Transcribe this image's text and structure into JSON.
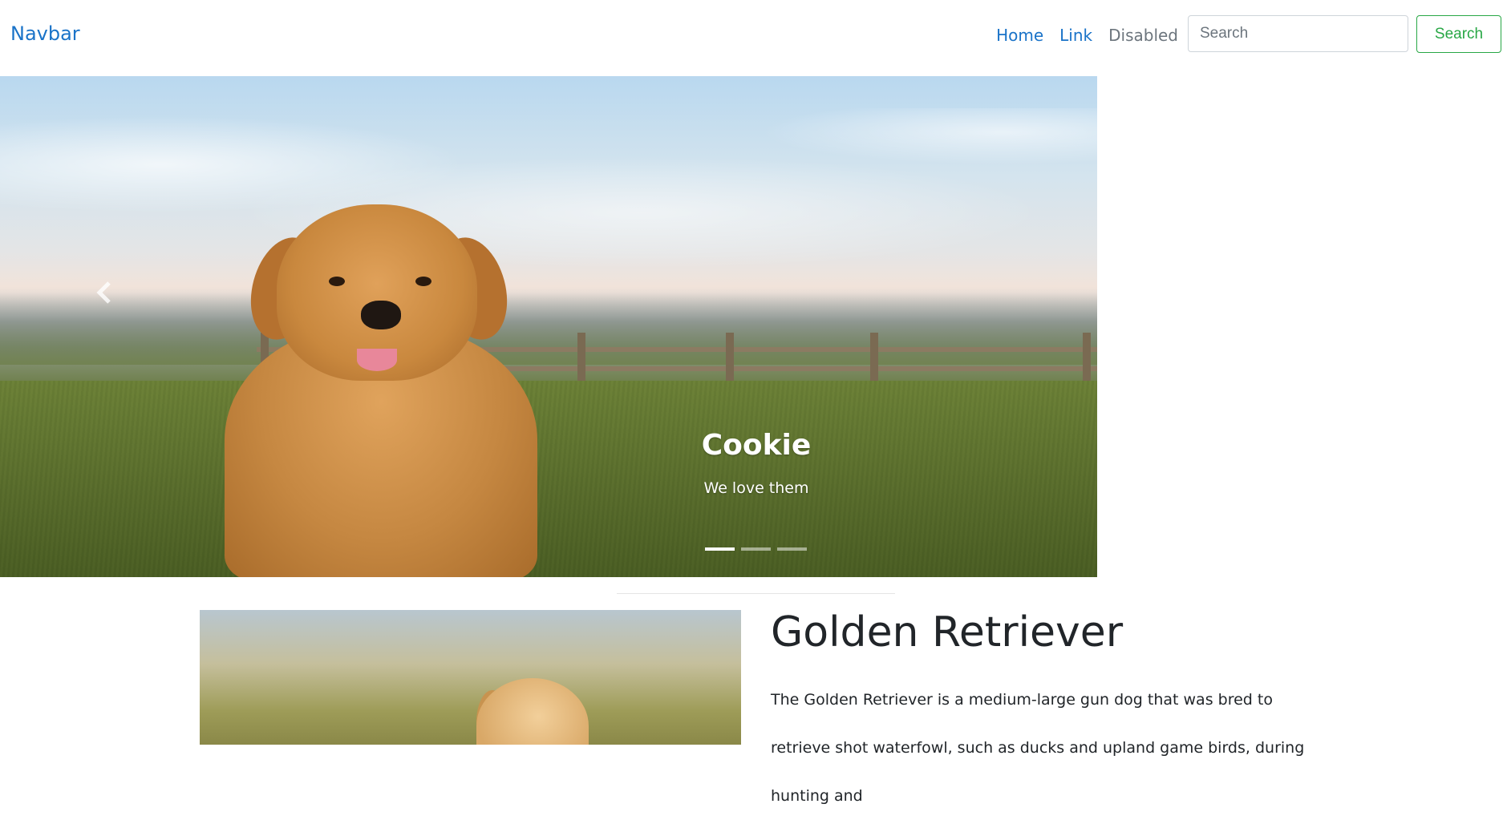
{
  "navbar": {
    "brand": "Navbar",
    "links": [
      {
        "label": "Home"
      },
      {
        "label": "Link"
      },
      {
        "label": "Disabled"
      }
    ],
    "search_placeholder": "Search",
    "search_button": "Search"
  },
  "carousel": {
    "prev_icon": "chevron-left-icon",
    "caption_title": "Cookie",
    "caption_text": "We love them",
    "indicator_count": 3,
    "active_indicator": 1
  },
  "article": {
    "title": "Golden Retriever",
    "text": "The Golden Retriever is a medium-large gun dog that was bred to retrieve shot waterfowl, such as ducks and upland game birds, during hunting and"
  },
  "colors": {
    "link": "#1a73c8",
    "disabled": "#6c757d",
    "success": "#28a745",
    "text": "#212529"
  }
}
